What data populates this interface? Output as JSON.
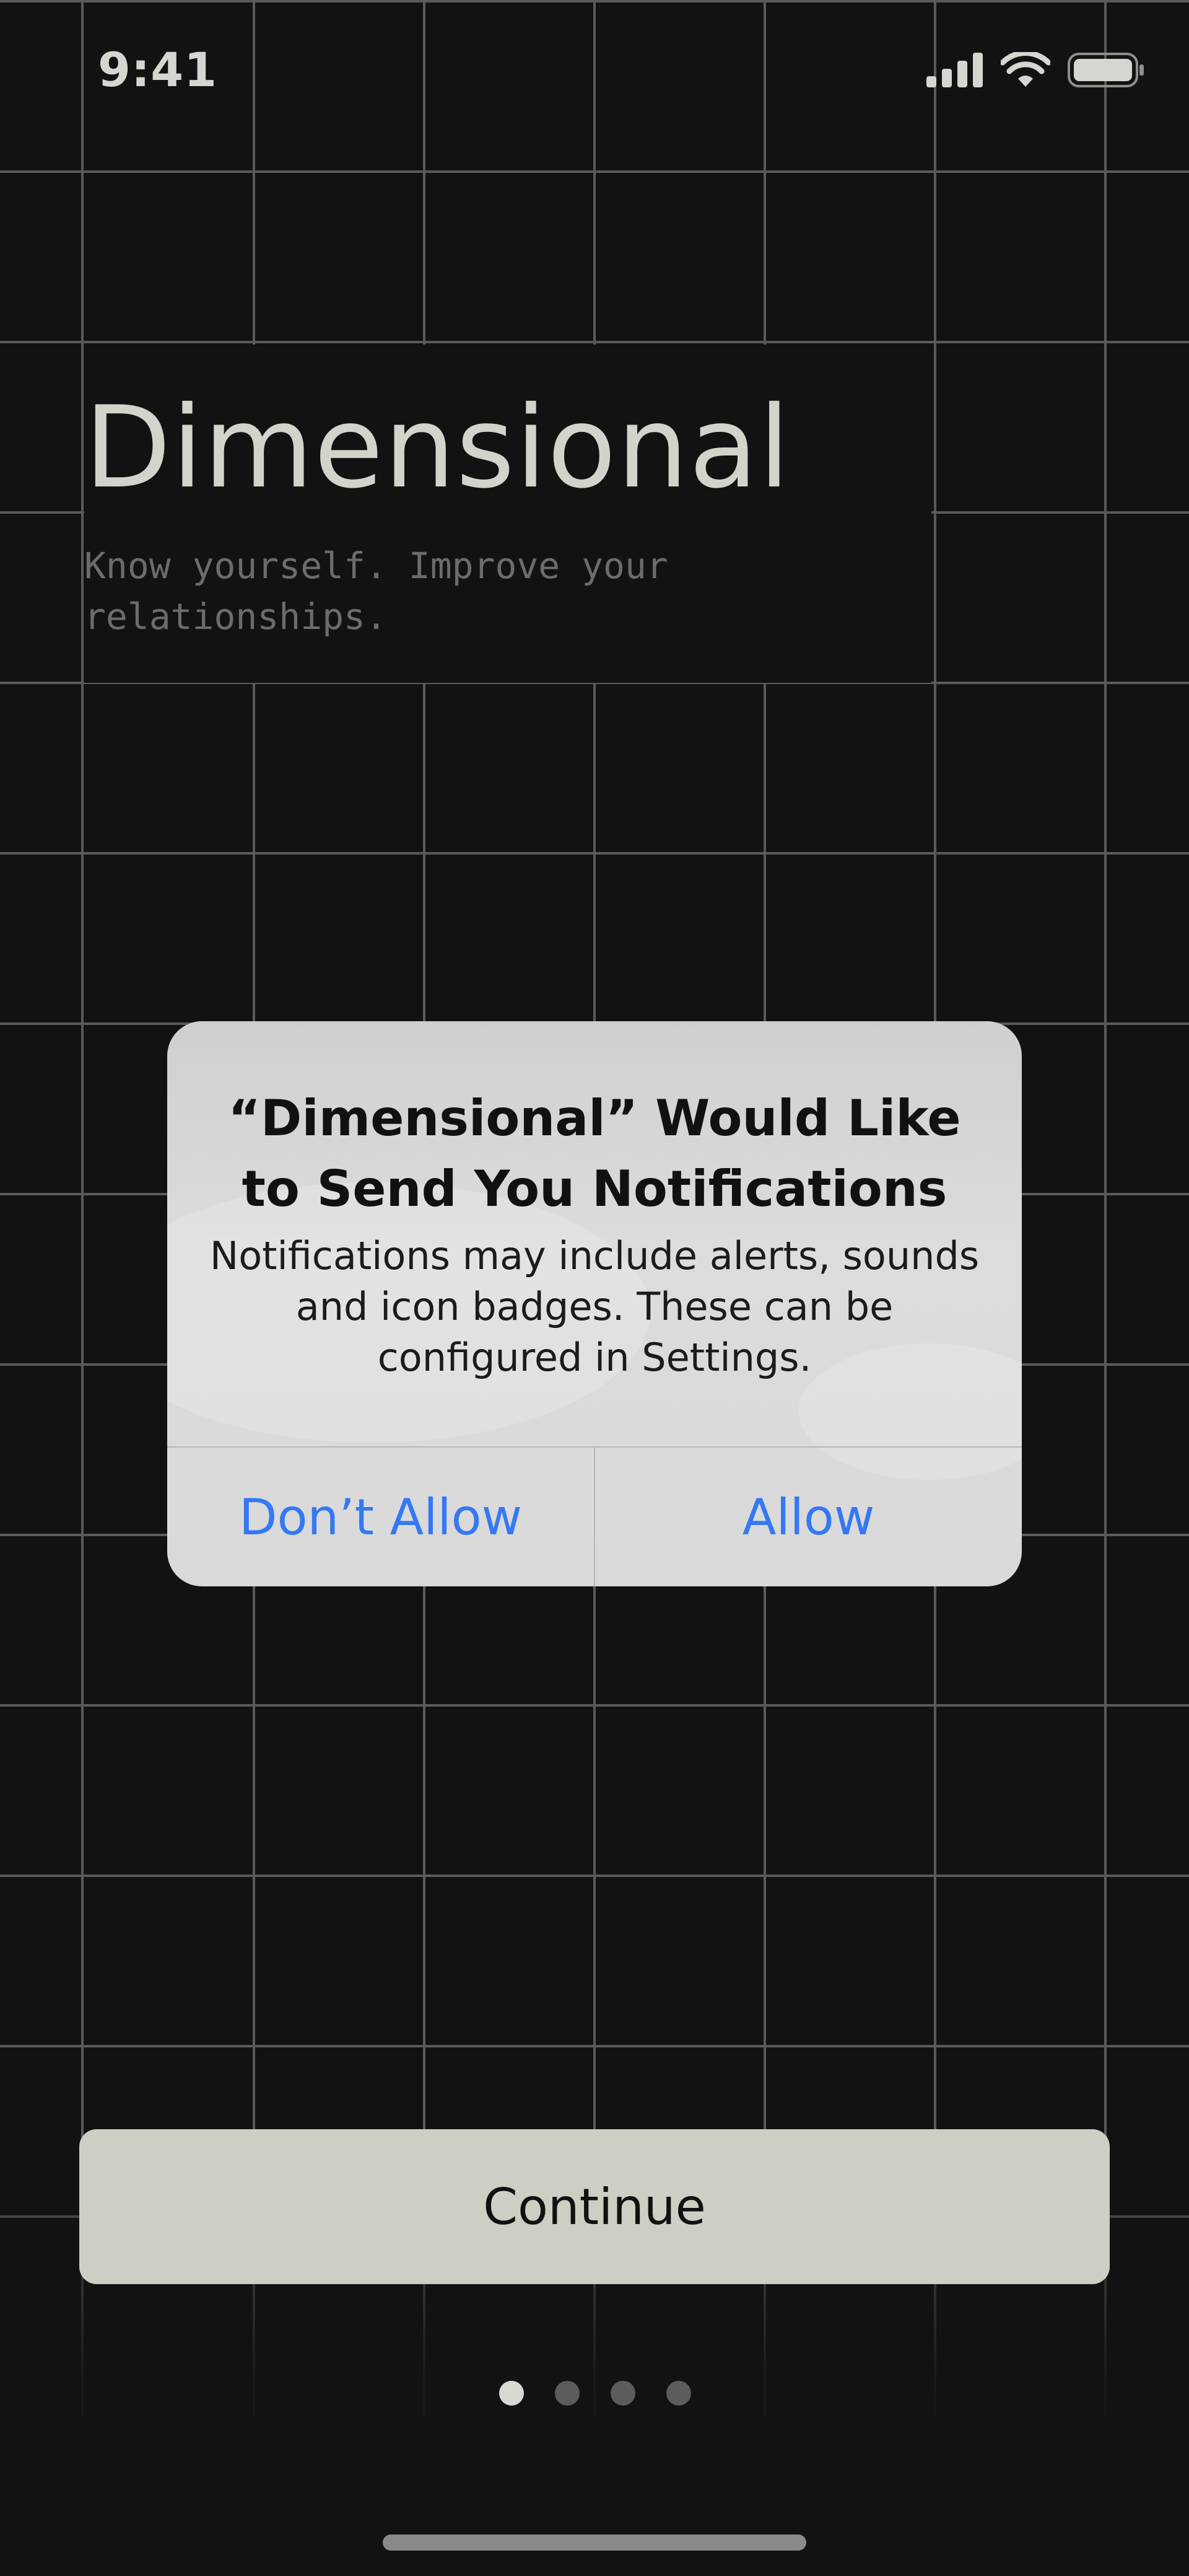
{
  "status_bar": {
    "time": "9:41",
    "icons": [
      "cellular-signal-icon",
      "wifi-icon",
      "battery-icon"
    ]
  },
  "header": {
    "title": "Dimensional",
    "tagline": "Know yourself. Improve your relationships."
  },
  "alert": {
    "title": "“Dimensional” Would Like to Send You Notifications",
    "message": "Notifications may include alerts, sounds and icon badges. These can be configured in Settings.",
    "dont_allow_label": "Don’t Allow",
    "allow_label": "Allow"
  },
  "continue_label": "Continue",
  "pager": {
    "total": 4,
    "current": 1
  },
  "colors": {
    "background": "#121212",
    "grid_line": "#5a5a5a",
    "title_text": "#d3d3cb",
    "tagline_text": "#6c6c68",
    "alert_bg": "#d9d9d9",
    "alert_button": "#3478f6",
    "continue_bg": "#cecec5"
  }
}
